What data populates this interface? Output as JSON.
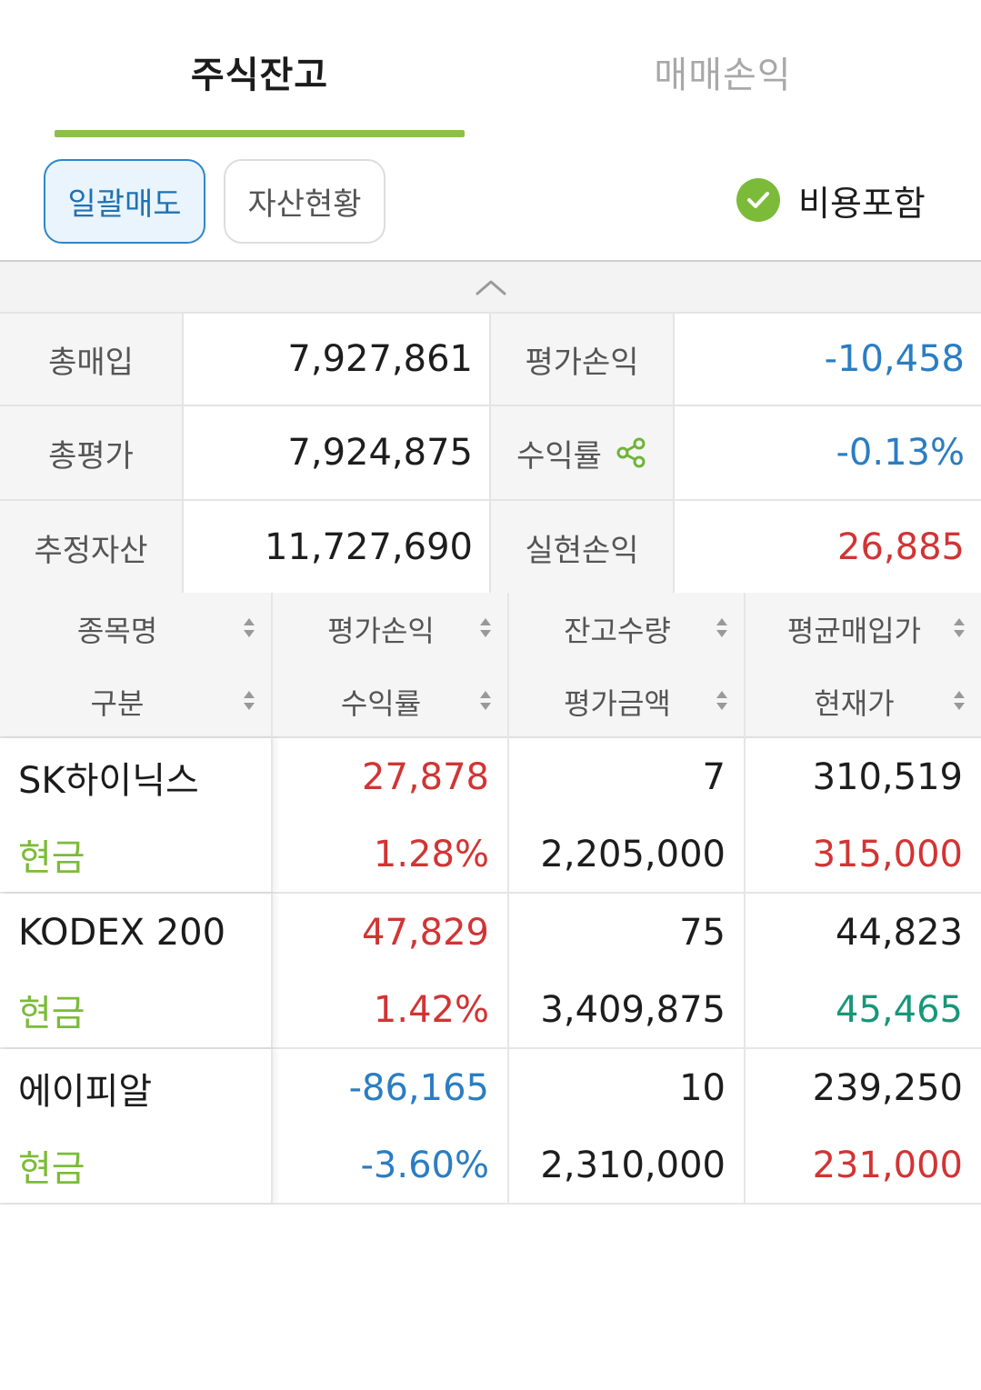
{
  "tabs": {
    "active": "주식잔고",
    "inactive": "매매손익"
  },
  "buttons": {
    "bulk_sell": "일괄매도",
    "asset_status": "자산현황"
  },
  "fee_toggle": {
    "label": "비용포함",
    "checked": true
  },
  "summary": {
    "total_purchase_label": "총매입",
    "total_purchase": "7,927,861",
    "eval_pl_label": "평가손익",
    "eval_pl": "-10,458",
    "total_eval_label": "총평가",
    "total_eval": "7,924,875",
    "return_label": "수익률",
    "return": "-0.13%",
    "est_asset_label": "추정자산",
    "est_asset": "11,727,690",
    "realized_pl_label": "실현손익",
    "realized_pl": "26,885"
  },
  "table": {
    "headers": {
      "name": "종목명",
      "type": "구분",
      "eval_pl": "평가손익",
      "return": "수익률",
      "qty": "잔고수량",
      "eval_amount": "평가금액",
      "avg_price": "평균매입가",
      "cur_price": "현재가"
    },
    "rows": [
      {
        "name": "SK하이닉스",
        "type": "현금",
        "eval_pl": "27,878",
        "return": "1.28%",
        "qty": "7",
        "eval_amount": "2,205,000",
        "avg_price": "310,519",
        "cur_price": "315,000"
      },
      {
        "name": "KODEX 200",
        "type": "현금",
        "eval_pl": "47,829",
        "return": "1.42%",
        "qty": "75",
        "eval_amount": "3,409,875",
        "avg_price": "44,823",
        "cur_price": "45,465"
      },
      {
        "name": "에이피알",
        "type": "현금",
        "eval_pl": "-86,165",
        "return": "-3.60%",
        "qty": "10",
        "eval_amount": "2,310,000",
        "avg_price": "239,250",
        "cur_price": "231,000"
      }
    ]
  },
  "colors": {
    "accent_green": "#8dc04b",
    "positive_red": "#d23434",
    "negative_blue": "#2b7dc2",
    "current_price_teal": "#17977a"
  }
}
